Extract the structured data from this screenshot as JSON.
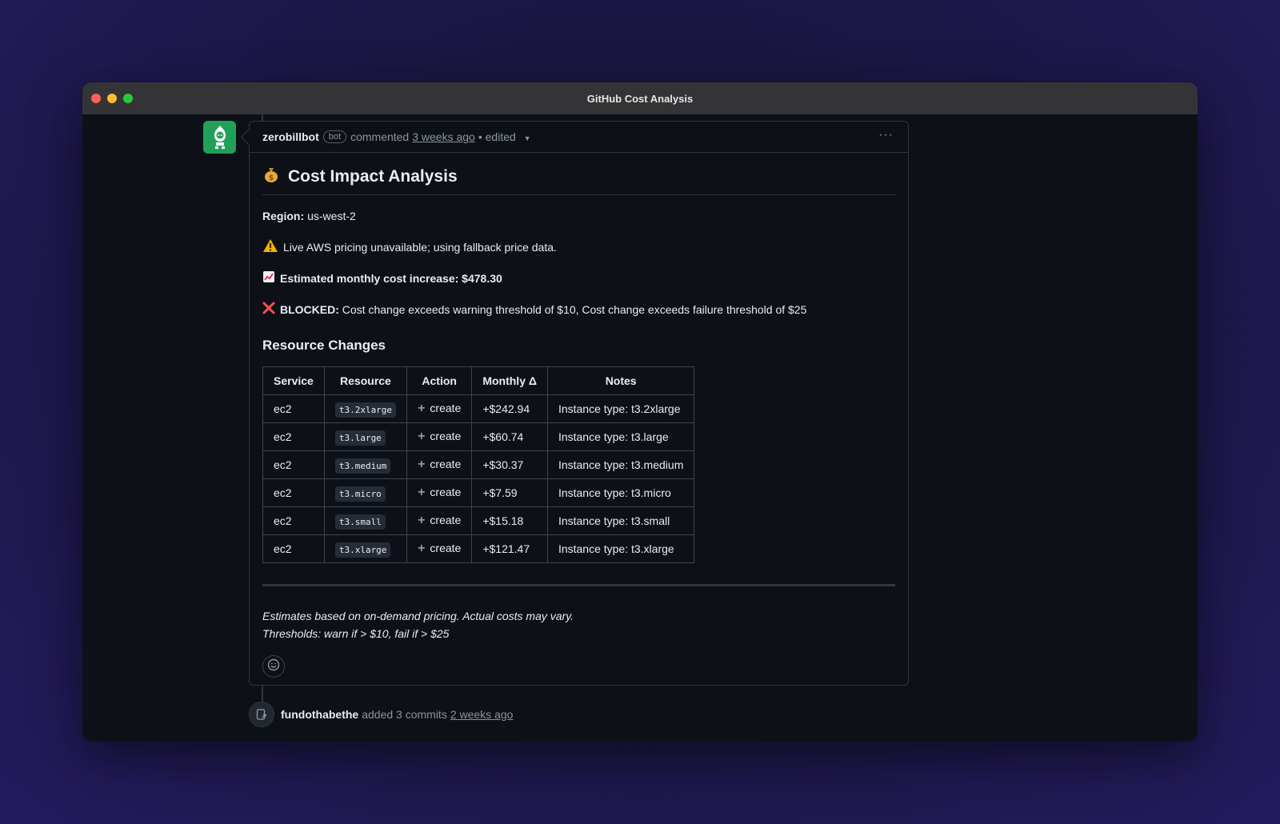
{
  "window": {
    "title": "GitHub Cost Analysis"
  },
  "comment": {
    "author": "zerobillbot",
    "badge": "bot",
    "action": "commented",
    "time": "3 weeks ago",
    "edited": "• edited",
    "more": "···"
  },
  "report": {
    "title": "Cost Impact Analysis",
    "region_label": "Region:",
    "region_value": "us-west-2",
    "warning": "Live AWS pricing unavailable; using fallback price data.",
    "estimate": "Estimated monthly cost increase: $478.30",
    "blocked_label": "BLOCKED:",
    "blocked_text": "Cost change exceeds warning threshold of $10, Cost change exceeds failure threshold of $25",
    "section_title": "Resource Changes",
    "columns": [
      "Service",
      "Resource",
      "Action",
      "Monthly Δ",
      "Notes"
    ],
    "rows": [
      {
        "service": "ec2",
        "resource": "t3.2xlarge",
        "action": "create",
        "delta": "+$242.94",
        "notes": "Instance type: t3.2xlarge"
      },
      {
        "service": "ec2",
        "resource": "t3.large",
        "action": "create",
        "delta": "+$60.74",
        "notes": "Instance type: t3.large"
      },
      {
        "service": "ec2",
        "resource": "t3.medium",
        "action": "create",
        "delta": "+$30.37",
        "notes": "Instance type: t3.medium"
      },
      {
        "service": "ec2",
        "resource": "t3.micro",
        "action": "create",
        "delta": "+$7.59",
        "notes": "Instance type: t3.micro"
      },
      {
        "service": "ec2",
        "resource": "t3.small",
        "action": "create",
        "delta": "+$15.18",
        "notes": "Instance type: t3.small"
      },
      {
        "service": "ec2",
        "resource": "t3.xlarge",
        "action": "create",
        "delta": "+$121.47",
        "notes": "Instance type: t3.xlarge"
      }
    ],
    "footnote_1": "Estimates based on on-demand pricing. Actual costs may vary.",
    "footnote_2": "Thresholds: warn if > $10, fail if > $25"
  },
  "event": {
    "user": "fundothabethe",
    "text": "added 3 commits",
    "time": "2 weeks ago"
  },
  "icons": {
    "avatar": "robot-icon",
    "title": "money-bag-icon",
    "warning": "warning-icon",
    "estimate": "chart-increasing-icon",
    "blocked": "cross-mark-icon",
    "action": "plus-icon",
    "reaction": "smiley-icon",
    "event": "commit-push-icon"
  },
  "colors": {
    "avatar_bg": "#21a05a",
    "warning": "#f0b400",
    "blocked": "#f85149"
  }
}
